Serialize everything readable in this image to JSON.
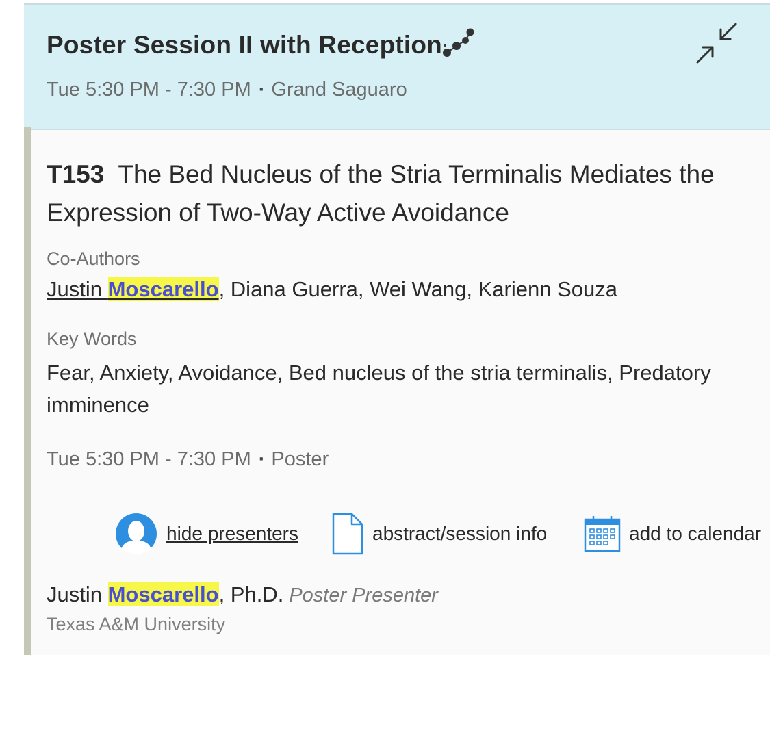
{
  "session": {
    "title": "Poster Session II with Reception",
    "time": "Tue 5:30 PM - 7:30 PM",
    "separator": "·",
    "location": "Grand Saguaro"
  },
  "abstract": {
    "code": "T153",
    "title": "The Bed Nucleus of the Stria Terminalis Mediates the Expression of Two-Way Active Avoidance",
    "coauthors_label": "Co-Authors",
    "first_author_first": "Justin",
    "first_author_last": "Moscarello",
    "other_authors": ", Diana Guerra, Wei Wang, Karienn Souza",
    "keywords_label": "Key Words",
    "keywords": "Fear, Anxiety, Avoidance, Bed nucleus of the stria terminalis, Predatory imminence",
    "time": "Tue 5:30 PM - 7:30 PM",
    "separator": "·",
    "type": "Poster"
  },
  "actions": {
    "hide_presenters": "hide presenters",
    "abstract_info": "abstract/session info",
    "add_calendar": "add to calendar"
  },
  "presenter": {
    "first_name": "Justin",
    "last_name": "Moscarello",
    "suffix": ", Ph.D.",
    "role": "Poster Presenter",
    "organization": "Texas A&M University"
  },
  "colors": {
    "header_bg": "#d6f0f6",
    "highlight_bg": "#f7f74a",
    "highlight_text": "#4a4fd1",
    "accent_blue": "#2e8fe0",
    "left_bar": "#c5c8b5"
  },
  "icons": {
    "session": "network-dots-icon",
    "collapse": "collapse-arrows-icon",
    "presenter": "user-avatar-icon",
    "document": "document-icon",
    "calendar": "calendar-icon"
  }
}
